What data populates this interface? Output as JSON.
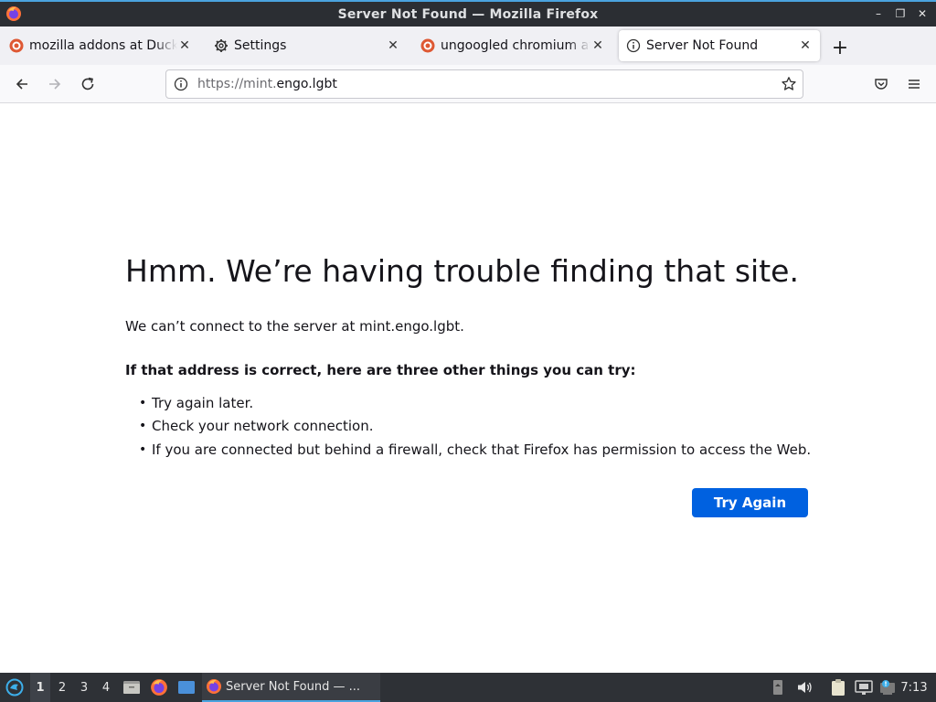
{
  "window": {
    "title": "Server Not Found — Mozilla Firefox",
    "controls": [
      "minimize-icon",
      "restore-icon",
      "close-icon"
    ]
  },
  "tabs": [
    {
      "label": "mozilla addons at DuckDuckGo",
      "icon": "duckduckgo-icon",
      "active": false
    },
    {
      "label": "Settings",
      "icon": "gear-icon",
      "active": false
    },
    {
      "label": "ungoogled chromium at DuckDuckGo",
      "icon": "duckduckgo-icon",
      "active": false
    },
    {
      "label": "Server Not Found",
      "icon": "info-icon",
      "active": true
    }
  ],
  "navbar": {
    "url_scheme": "https://mint.",
    "url_host": "engo.lgbt"
  },
  "error_page": {
    "heading": "Hmm. We’re having trouble finding that site.",
    "subtext": "We can’t connect to the server at mint.engo.lgbt.",
    "advice_heading": "If that address is correct, here are three other things you can try:",
    "tips": [
      "Try again later.",
      "Check your network connection.",
      "If you are connected but behind a firewall, check that Firefox has permission to access the Web."
    ],
    "try_again_label": "Try Again"
  },
  "taskbar": {
    "workspaces": [
      "1",
      "2",
      "3",
      "4"
    ],
    "active_workspace": "1",
    "task_label": "Server Not Found — ...",
    "clock": "7:13"
  },
  "colors": {
    "accent": "#0061e0",
    "titlebar": "#2b2e33",
    "taskbar": "#2e3136"
  }
}
